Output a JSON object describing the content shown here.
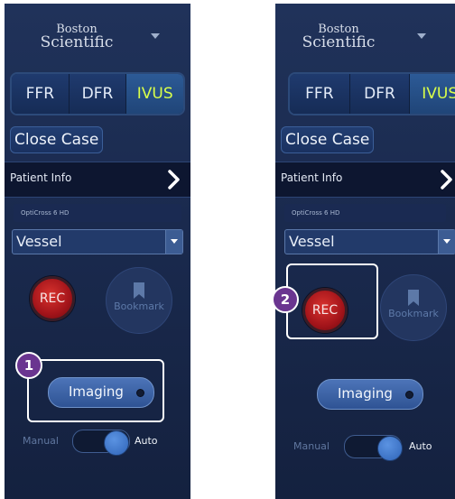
{
  "colors": {
    "panel_bg": "#1c2c52",
    "active_mode": "#d9ff4a",
    "highlight_badge": "#6a3590",
    "rec_red": "#c21e22",
    "toggle_knob": "#3c76cc"
  },
  "panels": [
    {
      "brand": {
        "line1": "Boston",
        "line2": "Scientific",
        "menu_icon": "caret-down-icon"
      },
      "modes": [
        "FFR",
        "DFR",
        "IVUS"
      ],
      "active_mode": "IVUS",
      "close_case_label": "Close Case",
      "patient_info_label": "Patient Info",
      "patient_info_icon": "chevron-right-icon",
      "device_label": "OptiCross 6 HD",
      "vessel_value": "Vessel",
      "rec_label": "REC",
      "bookmark_label": "Bookmark",
      "imaging_label": "Imaging",
      "toggle": {
        "manual_label": "Manual",
        "auto_label": "Auto",
        "state": "Auto"
      },
      "callout": {
        "number": "1",
        "target": "Imaging"
      }
    },
    {
      "brand": {
        "line1": "Boston",
        "line2": "Scientific",
        "menu_icon": "caret-down-icon"
      },
      "modes": [
        "FFR",
        "DFR",
        "IVUS"
      ],
      "active_mode": "IVUS",
      "close_case_label": "Close Case",
      "patient_info_label": "Patient Info",
      "patient_info_icon": "chevron-right-icon",
      "device_label": "OptiCross 6 HD",
      "vessel_value": "Vessel",
      "rec_label": "REC",
      "bookmark_label": "Bookmark",
      "imaging_label": "Imaging",
      "toggle": {
        "manual_label": "Manual",
        "auto_label": "Auto",
        "state": "Auto"
      },
      "callout": {
        "number": "2",
        "target": "REC"
      }
    }
  ]
}
